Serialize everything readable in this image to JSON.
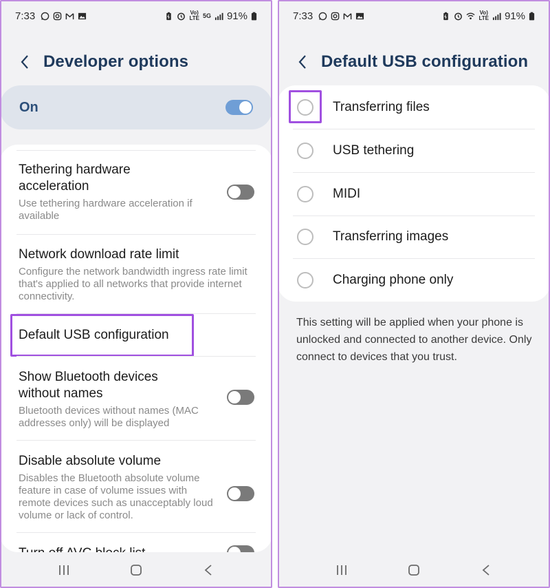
{
  "left": {
    "status": {
      "time": "7:33",
      "battery": "91%",
      "volte": "Vo)",
      "lte": "LTE",
      "fiveg": "5G"
    },
    "title": "Developer options",
    "master": {
      "label": "On",
      "state": "on"
    },
    "items": [
      {
        "title": "Tethering hardware acceleration",
        "subtitle": "Use tethering hardware acceleration if available",
        "toggle": "off"
      },
      {
        "title": "Network download rate limit",
        "subtitle": "Configure the network bandwidth ingress rate limit that's applied to all networks that provide internet connectivity."
      },
      {
        "title": "Default USB configuration",
        "highlighted": true
      },
      {
        "title": "Show Bluetooth devices without names",
        "subtitle": "Bluetooth devices without names (MAC addresses only) will be displayed",
        "toggle": "off"
      },
      {
        "title": "Disable absolute volume",
        "subtitle": "Disables the Bluetooth absolute volume feature in case of volume issues with remote devices such as unacceptably loud volume or lack of control.",
        "toggle": "off"
      },
      {
        "title": "Turn off AVC block list",
        "toggle": "off"
      }
    ]
  },
  "right": {
    "status": {
      "time": "7:33",
      "battery": "91%",
      "volte": "Vo)",
      "lte": "LTE"
    },
    "title": "Default USB configuration",
    "options": [
      {
        "label": "Transferring files",
        "highlighted": true
      },
      {
        "label": "USB tethering"
      },
      {
        "label": "MIDI"
      },
      {
        "label": "Transferring images"
      },
      {
        "label": "Charging phone only"
      }
    ],
    "note": "This setting will be applied when your phone is unlocked and connected to another device. Only connect to devices that you trust."
  },
  "icons": {
    "status_left": [
      "whatsapp-icon",
      "instagram-icon",
      "gmail-icon",
      "gallery-icon"
    ],
    "status_right": [
      "battery-saver-icon",
      "alarm-icon",
      "volte-icon",
      "5g-icon",
      "signal-icon",
      "battery-icon"
    ],
    "nav": [
      "recents-icon",
      "home-icon",
      "back-icon"
    ]
  },
  "colors": {
    "accent_highlight": "#a050e0",
    "title": "#1f3a5c",
    "toggle_on": "#6f9ed6",
    "toggle_off": "#7a7a7a",
    "panel_bg": "#f2f2f4"
  }
}
